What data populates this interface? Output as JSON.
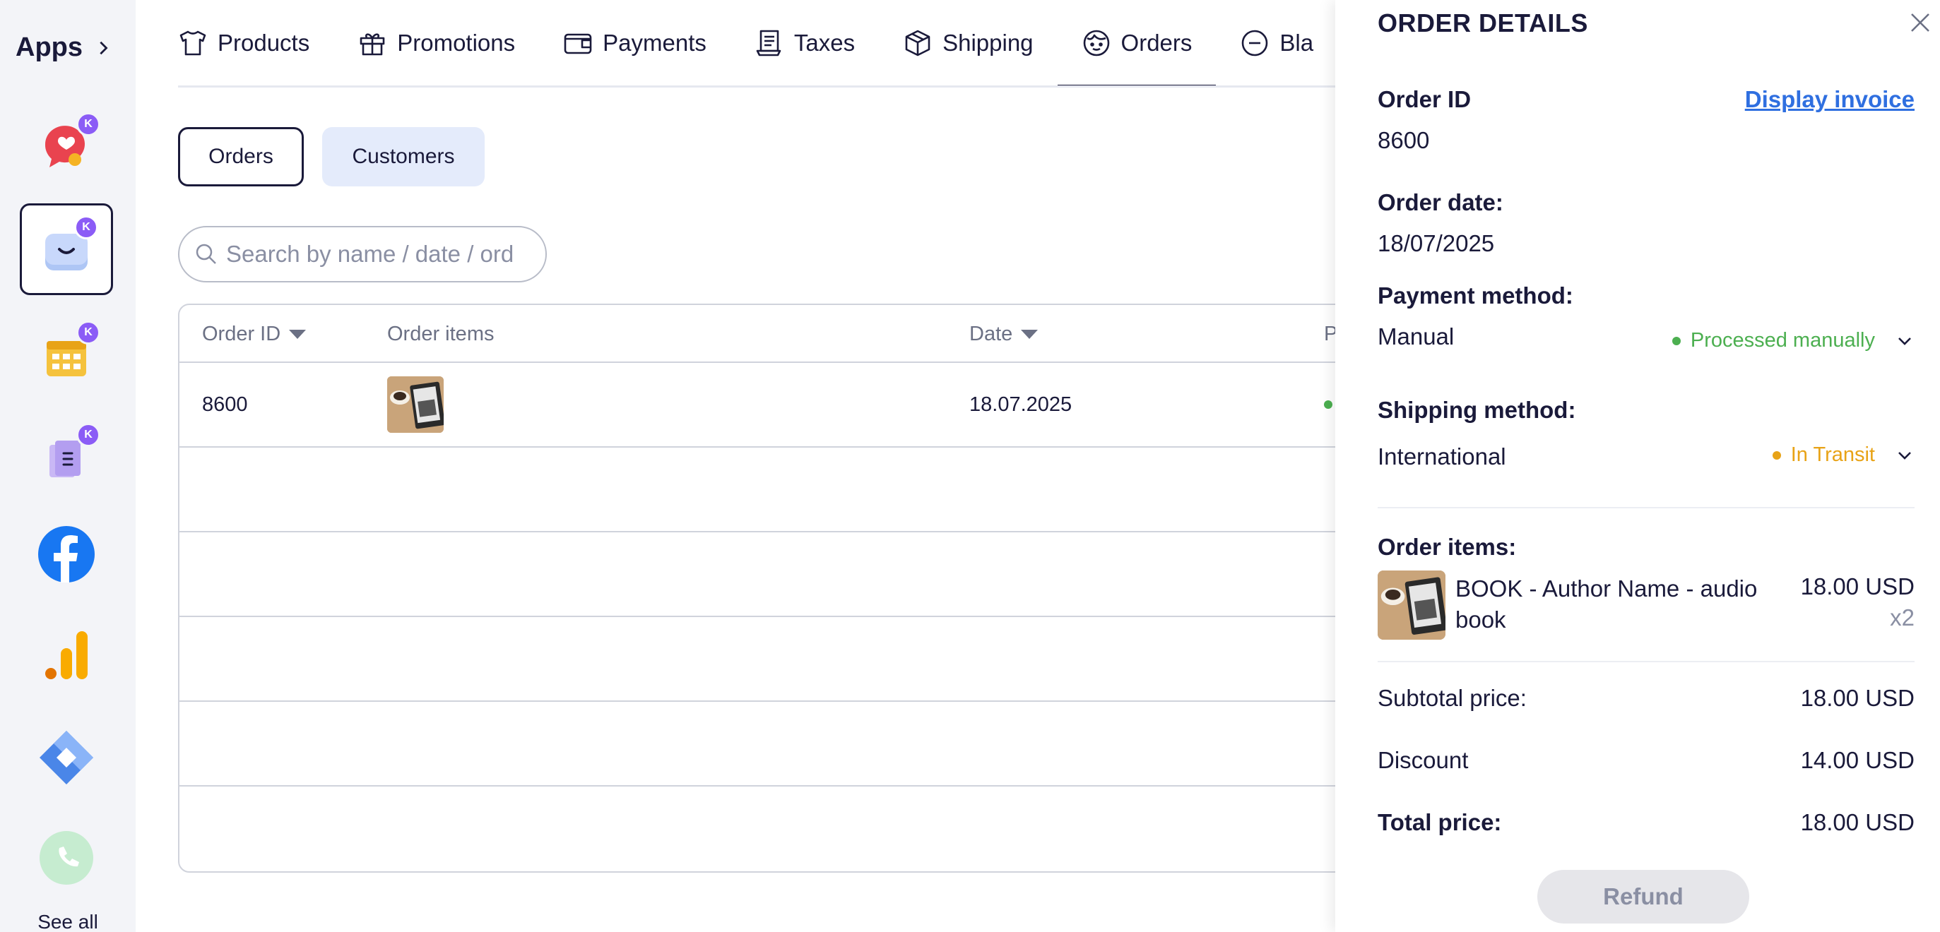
{
  "sidebar": {
    "title": "Apps",
    "badge": "K",
    "see_all": "See all",
    "apps": [
      {
        "icon": "chat-heart-icon",
        "badge": true
      },
      {
        "icon": "shopping-bag-icon",
        "badge": true,
        "active": true
      },
      {
        "icon": "calendar-icon",
        "badge": true
      },
      {
        "icon": "document-icon",
        "badge": true
      },
      {
        "icon": "facebook-icon",
        "badge": false
      },
      {
        "icon": "analytics-icon",
        "badge": false
      },
      {
        "icon": "tag-manager-icon",
        "badge": false
      },
      {
        "icon": "phone-icon",
        "badge": false
      }
    ]
  },
  "tabs": [
    {
      "label": "Products",
      "icon": "shirt-icon"
    },
    {
      "label": "Promotions",
      "icon": "gift-icon"
    },
    {
      "label": "Payments",
      "icon": "wallet-icon"
    },
    {
      "label": "Taxes",
      "icon": "receipt-icon"
    },
    {
      "label": "Shipping",
      "icon": "box-icon"
    },
    {
      "label": "Orders",
      "icon": "face-icon",
      "active": true
    },
    {
      "label": "Bla",
      "icon": "minus-circle-icon"
    }
  ],
  "segments": {
    "orders": "Orders",
    "customers": "Customers"
  },
  "search": {
    "placeholder": "Search by name / date / ord"
  },
  "table": {
    "headers": {
      "order_id": "Order ID",
      "order_items": "Order items",
      "date": "Date",
      "payment": "P"
    },
    "rows": [
      {
        "order_id": "8600",
        "date": "18.07.2025"
      }
    ]
  },
  "panel": {
    "title": "ORDER DETAILS",
    "order_id_label": "Order ID",
    "order_id": "8600",
    "display_invoice": "Display invoice",
    "order_date_label": "Order date:",
    "order_date": "18/07/2025",
    "payment_label": "Payment method:",
    "payment_value": "Manual",
    "payment_status": "Processed manually",
    "shipping_label": "Shipping method:",
    "shipping_value": "International",
    "shipping_status": "In Transit",
    "items_label": "Order items:",
    "item_name": "BOOK - Author Name - audio book",
    "item_price": "18.00 USD",
    "item_qty": "x2",
    "subtotal_label": "Subtotal price:",
    "subtotal": "18.00 USD",
    "discount_label": "Discount",
    "discount": "14.00 USD",
    "total_label": "Total price:",
    "total": "18.00 USD",
    "refund": "Refund"
  },
  "colors": {
    "accent": "#1a1a3a",
    "link": "#2f6fe0",
    "processed": "#4caf50",
    "in_transit": "#e8a317",
    "badge": "#8b5cf6"
  }
}
